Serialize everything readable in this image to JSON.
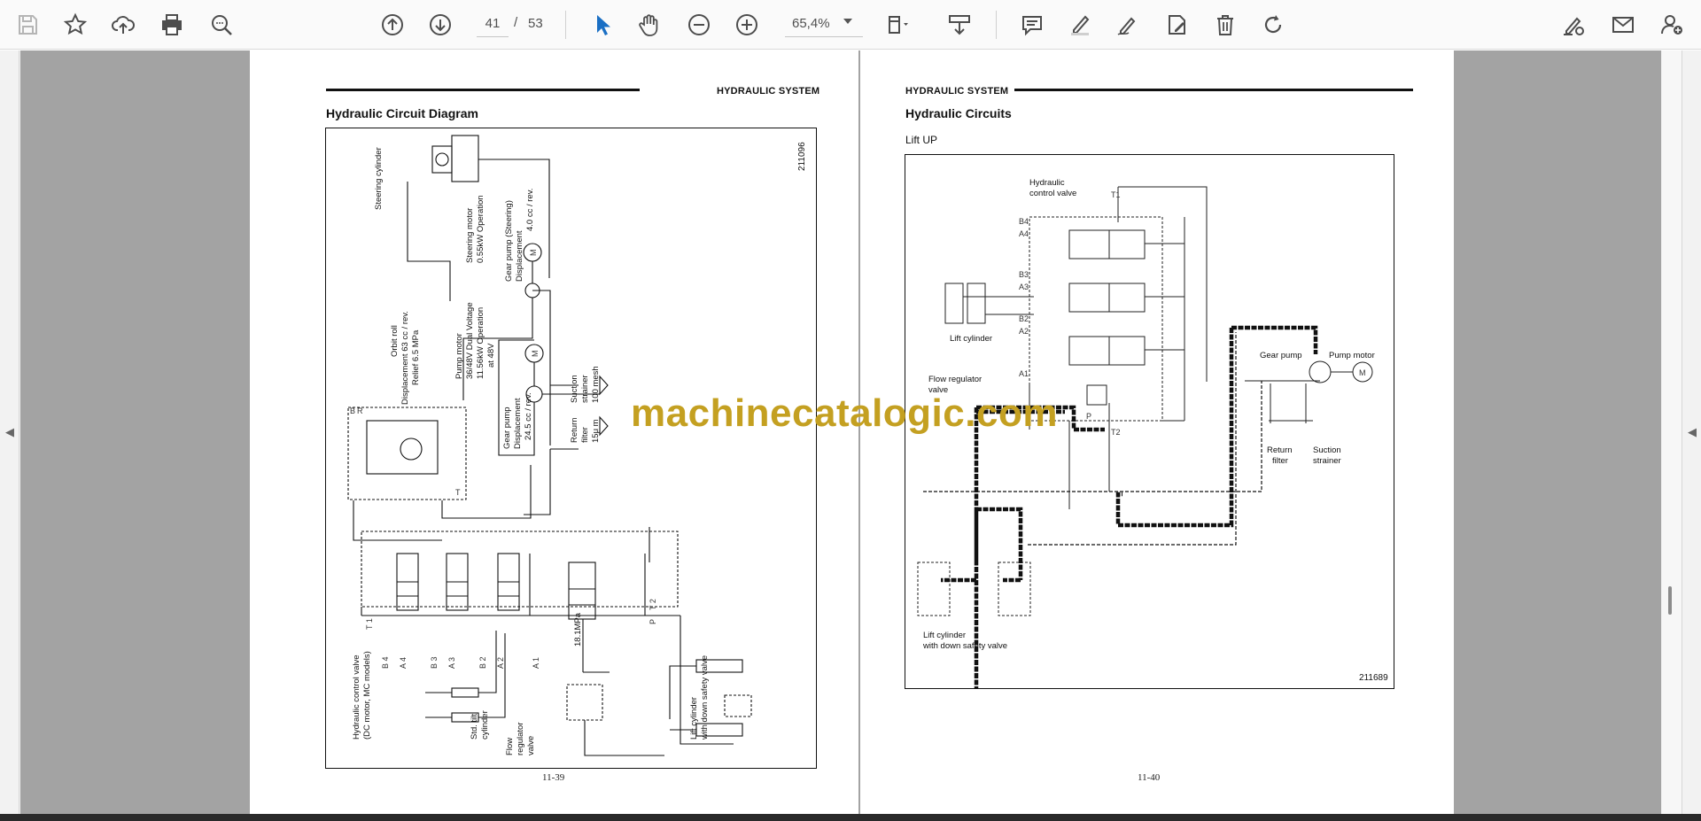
{
  "toolbar": {
    "current_page": "41",
    "page_separator": "/",
    "total_pages": "53",
    "zoom": "65,4%",
    "icons": [
      "save-icon",
      "bookmark-star-icon",
      "upload-cloud-icon",
      "print-icon",
      "zoom-search-icon",
      "page-up-icon",
      "page-down-icon",
      "select-cursor-icon",
      "hand-pan-icon",
      "zoom-out-icon",
      "zoom-in-icon",
      "fit-page-icon",
      "export-page-icon",
      "comment-icon",
      "highlight-pen-icon",
      "draw-icon",
      "edit-pdf-icon",
      "delete-icon",
      "rotate-icon",
      "fill-sign-icon",
      "email-icon",
      "share-user-icon"
    ],
    "accent_color": "#1a6fc4"
  },
  "left_page": {
    "header": "HYDRAULIC SYSTEM",
    "title": "Hydraulic Circuit Diagram",
    "figure_number": "211096",
    "page_number": "11-39",
    "labels": {
      "steering_cylinder": "Steering cylinder",
      "steering_motor": "Steering motor",
      "steering_motor_spec": "0.55kW Operation",
      "gear_pump_steering": "Gear pump (Steering)",
      "gear_pump_steering_disp": "Displacement",
      "gear_pump_steering_val": "4.0 cc / rev.",
      "orbit_roll": "Orbit roll",
      "orbit_roll_disp": "Displacement 63 cc / rev.",
      "orbit_roll_relief": "Relief  6.5 MPa",
      "pump_motor": "Pump motor",
      "pump_motor_voltage": "36/48V Dual Voltage",
      "pump_motor_power": "11.56kW Operation",
      "pump_motor_at": "at 48V",
      "gear_pump": "Gear pump",
      "gear_pump_disp": "Displacement",
      "gear_pump_val": "24.5 cc / rev.",
      "suction": "Suction",
      "strainer": "strainer",
      "mesh": "100 mesh",
      "return": "Return",
      "filter": "filter",
      "filter_size": "15μ m",
      "hcv_line1": "Hydraulic control valve",
      "hcv_line2": "(DC motor, MC models)",
      "std_tilt": "Std. tilt",
      "cylinder": "cylinder",
      "flow": "Flow",
      "regulator": "regulator",
      "valve": "valve",
      "lift_cylinder": "Lift cylinder",
      "lift_cyl_2": "with down safety valve",
      "pressure": "18.1MPa",
      "ports": [
        "B 4",
        "A 4",
        "B 3",
        "A 3",
        "B 2",
        "A 2",
        "A 1",
        "T 1",
        "T 2",
        "P",
        "B",
        "R",
        "T",
        "M",
        "M"
      ]
    }
  },
  "right_page": {
    "header": "HYDRAULIC SYSTEM",
    "title": "Hydraulic Circuits",
    "subtitle": "Lift UP",
    "figure_number": "211689",
    "page_number": "11-40",
    "labels": {
      "hcv_1": "Hydraulic",
      "hcv_2": "control valve",
      "lift_cylinder": "Lift cylinder",
      "flow_reg_1": "Flow regulator",
      "flow_reg_2": "valve",
      "gear_pump": "Gear pump",
      "pump_motor": "Pump motor",
      "return_filter_1": "Return",
      "return_filter_2": "filter",
      "suction_1": "Suction",
      "suction_2": "strainer",
      "lift_cyl_b1": "Lift cylinder",
      "lift_cyl_b2": "with down safety valve",
      "ports": [
        "B4",
        "A4",
        "B3",
        "A3",
        "B2",
        "A2",
        "A1",
        "T1",
        "T2",
        "P",
        "M"
      ]
    }
  },
  "watermark": "machinecatalogic.com"
}
